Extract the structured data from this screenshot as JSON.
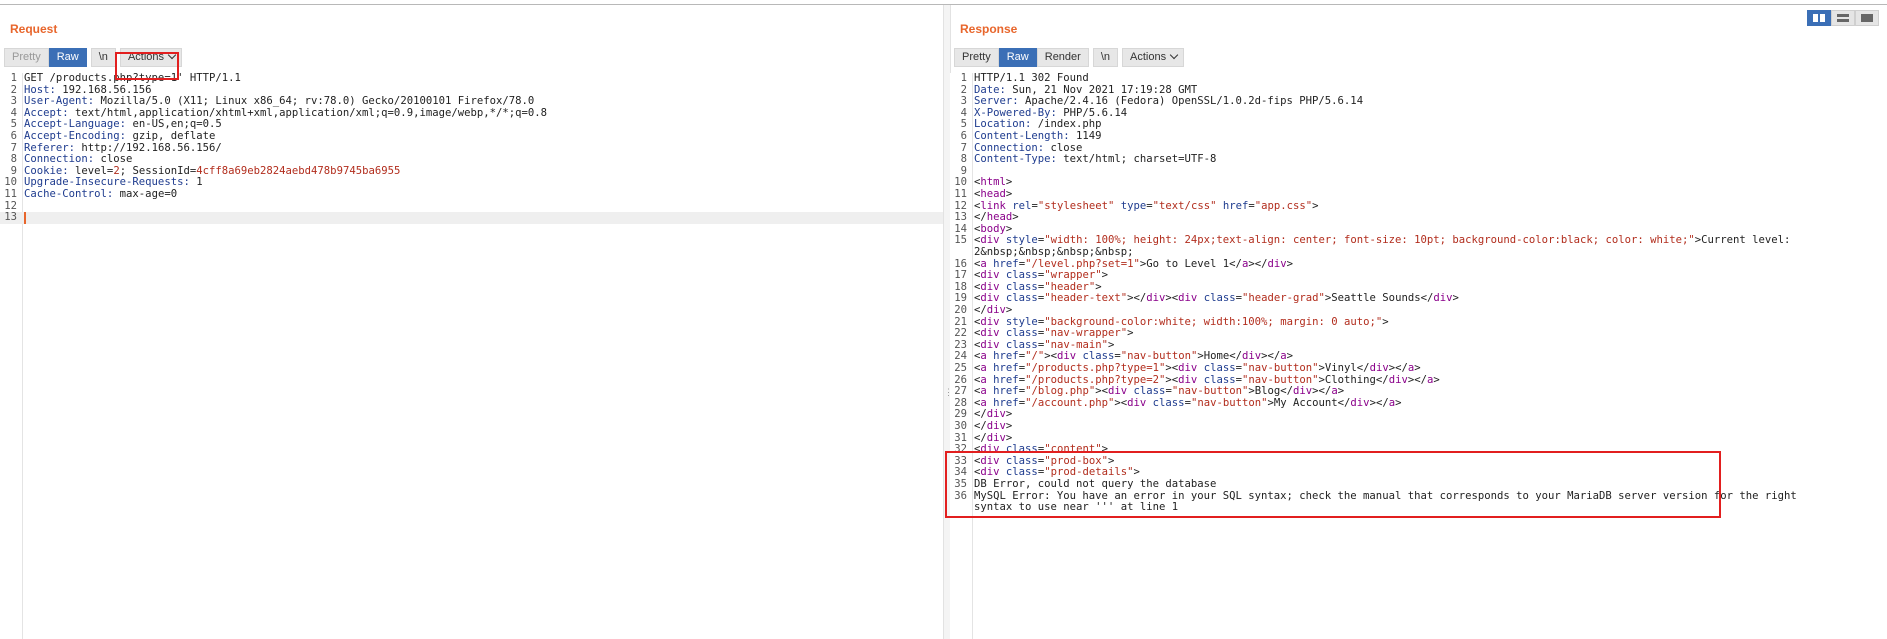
{
  "request": {
    "title": "Request",
    "tabs": {
      "pretty": "Pretty",
      "raw": "Raw",
      "newline": "\\n",
      "actions": "Actions"
    },
    "lines": [
      {
        "n": "1",
        "segs": [
          {
            "t": "GET /products.php?type=1' HTTP/1.1"
          }
        ]
      },
      {
        "n": "2",
        "segs": [
          {
            "t": "Host:",
            "c": "k"
          },
          {
            "t": " 192.168.56.156"
          }
        ]
      },
      {
        "n": "3",
        "segs": [
          {
            "t": "User-Agent:",
            "c": "k"
          },
          {
            "t": " Mozilla/5.0 (X11; Linux x86_64; rv:78.0) Gecko/20100101 Firefox/78.0"
          }
        ]
      },
      {
        "n": "4",
        "segs": [
          {
            "t": "Accept:",
            "c": "k"
          },
          {
            "t": " text/html,application/xhtml+xml,application/xml;q=0.9,image/webp,*/*;q=0.8"
          }
        ]
      },
      {
        "n": "5",
        "segs": [
          {
            "t": "Accept-Language:",
            "c": "k"
          },
          {
            "t": " en-US,en;q=0.5"
          }
        ]
      },
      {
        "n": "6",
        "segs": [
          {
            "t": "Accept-Encoding:",
            "c": "k"
          },
          {
            "t": " gzip, deflate"
          }
        ]
      },
      {
        "n": "7",
        "segs": [
          {
            "t": "Referer:",
            "c": "k"
          },
          {
            "t": " http://192.168.56.156/"
          }
        ]
      },
      {
        "n": "8",
        "segs": [
          {
            "t": "Connection:",
            "c": "k"
          },
          {
            "t": " close"
          }
        ]
      },
      {
        "n": "9",
        "segs": [
          {
            "t": "Cookie:",
            "c": "k"
          },
          {
            "t": " level="
          },
          {
            "t": "2",
            "c": "r"
          },
          {
            "t": "; SessionId="
          },
          {
            "t": "4cff8a69eb2824aebd478b9745ba6955",
            "c": "r"
          }
        ]
      },
      {
        "n": "10",
        "segs": [
          {
            "t": "Upgrade-Insecure-Requests:",
            "c": "k"
          },
          {
            "t": " 1"
          }
        ]
      },
      {
        "n": "11",
        "segs": [
          {
            "t": "Cache-Control:",
            "c": "k"
          },
          {
            "t": " max-age=0"
          }
        ]
      },
      {
        "n": "12",
        "segs": []
      },
      {
        "n": "13",
        "segs": [],
        "current": true
      }
    ]
  },
  "response": {
    "title": "Response",
    "tabs": {
      "pretty": "Pretty",
      "raw": "Raw",
      "render": "Render",
      "newline": "\\n",
      "actions": "Actions"
    },
    "lines": [
      {
        "n": "1",
        "segs": [
          {
            "t": "HTTP/1.1 302 Found"
          }
        ]
      },
      {
        "n": "2",
        "segs": [
          {
            "t": "Date:",
            "c": "k"
          },
          {
            "t": " Sun, 21 Nov 2021 17:19:28 GMT"
          }
        ]
      },
      {
        "n": "3",
        "segs": [
          {
            "t": "Server:",
            "c": "k"
          },
          {
            "t": " Apache/2.4.16 (Fedora) OpenSSL/1.0.2d-fips PHP/5.6.14"
          }
        ]
      },
      {
        "n": "4",
        "segs": [
          {
            "t": "X-Powered-By:",
            "c": "k"
          },
          {
            "t": " PHP/5.6.14"
          }
        ]
      },
      {
        "n": "5",
        "segs": [
          {
            "t": "Location:",
            "c": "k"
          },
          {
            "t": " /index.php"
          }
        ]
      },
      {
        "n": "6",
        "segs": [
          {
            "t": "Content-Length:",
            "c": "k"
          },
          {
            "t": " 1149"
          }
        ]
      },
      {
        "n": "7",
        "segs": [
          {
            "t": "Connection:",
            "c": "k"
          },
          {
            "t": " close"
          }
        ]
      },
      {
        "n": "8",
        "segs": [
          {
            "t": "Content-Type:",
            "c": "k"
          },
          {
            "t": " text/html; charset=UTF-8"
          }
        ]
      },
      {
        "n": "9",
        "segs": []
      },
      {
        "n": "10",
        "segs": [
          {
            "t": "<"
          },
          {
            "t": "html",
            "c": "tag"
          },
          {
            "t": ">"
          }
        ]
      },
      {
        "n": "11",
        "segs": [
          {
            "t": "<"
          },
          {
            "t": "head",
            "c": "tag"
          },
          {
            "t": ">"
          }
        ]
      },
      {
        "n": "12",
        "segs": [
          {
            "t": "<"
          },
          {
            "t": "link",
            "c": "tag"
          },
          {
            "t": " "
          },
          {
            "t": "rel",
            "c": "attr"
          },
          {
            "t": "="
          },
          {
            "t": "\"stylesheet\"",
            "c": "str"
          },
          {
            "t": " "
          },
          {
            "t": "type",
            "c": "attr"
          },
          {
            "t": "="
          },
          {
            "t": "\"text/css\"",
            "c": "str"
          },
          {
            "t": " "
          },
          {
            "t": "href",
            "c": "attr"
          },
          {
            "t": "="
          },
          {
            "t": "\"app.css\"",
            "c": "str"
          },
          {
            "t": ">"
          }
        ]
      },
      {
        "n": "13",
        "segs": [
          {
            "t": "</"
          },
          {
            "t": "head",
            "c": "tag"
          },
          {
            "t": ">"
          }
        ]
      },
      {
        "n": "14",
        "segs": [
          {
            "t": "<"
          },
          {
            "t": "body",
            "c": "tag"
          },
          {
            "t": ">"
          }
        ]
      },
      {
        "n": "15",
        "segs": [
          {
            "t": "<"
          },
          {
            "t": "div",
            "c": "tag"
          },
          {
            "t": " "
          },
          {
            "t": "style",
            "c": "attr"
          },
          {
            "t": "="
          },
          {
            "t": "\"width: 100%; height: 24px;text-align: center; font-size: 10pt; background-color:black; color: white;\"",
            "c": "str"
          },
          {
            "t": ">Current level:"
          }
        ]
      },
      {
        "n": "",
        "segs": [
          {
            "t": "2&nbsp;&nbsp;&nbsp;&nbsp;"
          }
        ]
      },
      {
        "n": "16",
        "segs": [
          {
            "t": "<"
          },
          {
            "t": "a",
            "c": "tag"
          },
          {
            "t": " "
          },
          {
            "t": "href",
            "c": "attr"
          },
          {
            "t": "="
          },
          {
            "t": "\"/level.php?set=1\"",
            "c": "str"
          },
          {
            "t": ">Go to Level 1</"
          },
          {
            "t": "a",
            "c": "tag"
          },
          {
            "t": "></"
          },
          {
            "t": "div",
            "c": "tag"
          },
          {
            "t": ">"
          }
        ]
      },
      {
        "n": "17",
        "segs": [
          {
            "t": "<"
          },
          {
            "t": "div",
            "c": "tag"
          },
          {
            "t": " "
          },
          {
            "t": "class",
            "c": "attr"
          },
          {
            "t": "="
          },
          {
            "t": "\"wrapper\"",
            "c": "str"
          },
          {
            "t": ">"
          }
        ]
      },
      {
        "n": "18",
        "segs": [
          {
            "t": "<"
          },
          {
            "t": "div",
            "c": "tag"
          },
          {
            "t": " "
          },
          {
            "t": "class",
            "c": "attr"
          },
          {
            "t": "="
          },
          {
            "t": "\"header\"",
            "c": "str"
          },
          {
            "t": ">"
          }
        ]
      },
      {
        "n": "19",
        "segs": [
          {
            "t": "<"
          },
          {
            "t": "div",
            "c": "tag"
          },
          {
            "t": " "
          },
          {
            "t": "class",
            "c": "attr"
          },
          {
            "t": "="
          },
          {
            "t": "\"header-text\"",
            "c": "str"
          },
          {
            "t": "></"
          },
          {
            "t": "div",
            "c": "tag"
          },
          {
            "t": "><"
          },
          {
            "t": "div",
            "c": "tag"
          },
          {
            "t": " "
          },
          {
            "t": "class",
            "c": "attr"
          },
          {
            "t": "="
          },
          {
            "t": "\"header-grad\"",
            "c": "str"
          },
          {
            "t": ">Seattle Sounds</"
          },
          {
            "t": "div",
            "c": "tag"
          },
          {
            "t": ">"
          }
        ]
      },
      {
        "n": "20",
        "segs": [
          {
            "t": "</"
          },
          {
            "t": "div",
            "c": "tag"
          },
          {
            "t": ">"
          }
        ]
      },
      {
        "n": "21",
        "segs": [
          {
            "t": "<"
          },
          {
            "t": "div",
            "c": "tag"
          },
          {
            "t": " "
          },
          {
            "t": "style",
            "c": "attr"
          },
          {
            "t": "="
          },
          {
            "t": "\"background-color:white; width:100%; margin: 0 auto;\"",
            "c": "str"
          },
          {
            "t": ">"
          }
        ]
      },
      {
        "n": "22",
        "segs": [
          {
            "t": "<"
          },
          {
            "t": "div",
            "c": "tag"
          },
          {
            "t": " "
          },
          {
            "t": "class",
            "c": "attr"
          },
          {
            "t": "="
          },
          {
            "t": "\"nav-wrapper\"",
            "c": "str"
          },
          {
            "t": ">"
          }
        ]
      },
      {
        "n": "23",
        "segs": [
          {
            "t": "<"
          },
          {
            "t": "div",
            "c": "tag"
          },
          {
            "t": " "
          },
          {
            "t": "class",
            "c": "attr"
          },
          {
            "t": "="
          },
          {
            "t": "\"nav-main\"",
            "c": "str"
          },
          {
            "t": ">"
          }
        ]
      },
      {
        "n": "24",
        "segs": [
          {
            "t": "<"
          },
          {
            "t": "a",
            "c": "tag"
          },
          {
            "t": " "
          },
          {
            "t": "href",
            "c": "attr"
          },
          {
            "t": "="
          },
          {
            "t": "\"/\"",
            "c": "str"
          },
          {
            "t": "><"
          },
          {
            "t": "div",
            "c": "tag"
          },
          {
            "t": " "
          },
          {
            "t": "class",
            "c": "attr"
          },
          {
            "t": "="
          },
          {
            "t": "\"nav-button\"",
            "c": "str"
          },
          {
            "t": ">Home</"
          },
          {
            "t": "div",
            "c": "tag"
          },
          {
            "t": "></"
          },
          {
            "t": "a",
            "c": "tag"
          },
          {
            "t": ">"
          }
        ]
      },
      {
        "n": "25",
        "segs": [
          {
            "t": "<"
          },
          {
            "t": "a",
            "c": "tag"
          },
          {
            "t": " "
          },
          {
            "t": "href",
            "c": "attr"
          },
          {
            "t": "="
          },
          {
            "t": "\"/products.php?type=1\"",
            "c": "str"
          },
          {
            "t": "><"
          },
          {
            "t": "div",
            "c": "tag"
          },
          {
            "t": " "
          },
          {
            "t": "class",
            "c": "attr"
          },
          {
            "t": "="
          },
          {
            "t": "\"nav-button\"",
            "c": "str"
          },
          {
            "t": ">Vinyl</"
          },
          {
            "t": "div",
            "c": "tag"
          },
          {
            "t": "></"
          },
          {
            "t": "a",
            "c": "tag"
          },
          {
            "t": ">"
          }
        ]
      },
      {
        "n": "26",
        "segs": [
          {
            "t": "<"
          },
          {
            "t": "a",
            "c": "tag"
          },
          {
            "t": " "
          },
          {
            "t": "href",
            "c": "attr"
          },
          {
            "t": "="
          },
          {
            "t": "\"/products.php?type=2\"",
            "c": "str"
          },
          {
            "t": "><"
          },
          {
            "t": "div",
            "c": "tag"
          },
          {
            "t": " "
          },
          {
            "t": "class",
            "c": "attr"
          },
          {
            "t": "="
          },
          {
            "t": "\"nav-button\"",
            "c": "str"
          },
          {
            "t": ">Clothing</"
          },
          {
            "t": "div",
            "c": "tag"
          },
          {
            "t": "></"
          },
          {
            "t": "a",
            "c": "tag"
          },
          {
            "t": ">"
          }
        ]
      },
      {
        "n": "27",
        "segs": [
          {
            "t": "<"
          },
          {
            "t": "a",
            "c": "tag"
          },
          {
            "t": " "
          },
          {
            "t": "href",
            "c": "attr"
          },
          {
            "t": "="
          },
          {
            "t": "\"/blog.php\"",
            "c": "str"
          },
          {
            "t": "><"
          },
          {
            "t": "div",
            "c": "tag"
          },
          {
            "t": " "
          },
          {
            "t": "class",
            "c": "attr"
          },
          {
            "t": "="
          },
          {
            "t": "\"nav-button\"",
            "c": "str"
          },
          {
            "t": ">Blog</"
          },
          {
            "t": "div",
            "c": "tag"
          },
          {
            "t": "></"
          },
          {
            "t": "a",
            "c": "tag"
          },
          {
            "t": ">"
          }
        ]
      },
      {
        "n": "28",
        "segs": [
          {
            "t": "<"
          },
          {
            "t": "a",
            "c": "tag"
          },
          {
            "t": " "
          },
          {
            "t": "href",
            "c": "attr"
          },
          {
            "t": "="
          },
          {
            "t": "\"/account.php\"",
            "c": "str"
          },
          {
            "t": "><"
          },
          {
            "t": "div",
            "c": "tag"
          },
          {
            "t": " "
          },
          {
            "t": "class",
            "c": "attr"
          },
          {
            "t": "="
          },
          {
            "t": "\"nav-button\"",
            "c": "str"
          },
          {
            "t": ">My Account</"
          },
          {
            "t": "div",
            "c": "tag"
          },
          {
            "t": "></"
          },
          {
            "t": "a",
            "c": "tag"
          },
          {
            "t": ">"
          }
        ]
      },
      {
        "n": "29",
        "segs": [
          {
            "t": "</"
          },
          {
            "t": "div",
            "c": "tag"
          },
          {
            "t": ">"
          }
        ]
      },
      {
        "n": "30",
        "segs": [
          {
            "t": "</"
          },
          {
            "t": "div",
            "c": "tag"
          },
          {
            "t": ">"
          }
        ]
      },
      {
        "n": "31",
        "segs": [
          {
            "t": "</"
          },
          {
            "t": "div",
            "c": "tag"
          },
          {
            "t": ">"
          }
        ]
      },
      {
        "n": "32",
        "segs": [
          {
            "t": "<"
          },
          {
            "t": "div",
            "c": "tag"
          },
          {
            "t": " "
          },
          {
            "t": "class",
            "c": "attr"
          },
          {
            "t": "="
          },
          {
            "t": "\"content\"",
            "c": "str"
          },
          {
            "t": ">"
          }
        ]
      },
      {
        "n": "33",
        "segs": [
          {
            "t": "<"
          },
          {
            "t": "div",
            "c": "tag"
          },
          {
            "t": " "
          },
          {
            "t": "class",
            "c": "attr"
          },
          {
            "t": "="
          },
          {
            "t": "\"prod-box\"",
            "c": "str"
          },
          {
            "t": ">"
          }
        ]
      },
      {
        "n": "34",
        "segs": [
          {
            "t": "<"
          },
          {
            "t": "div",
            "c": "tag"
          },
          {
            "t": " "
          },
          {
            "t": "class",
            "c": "attr"
          },
          {
            "t": "="
          },
          {
            "t": "\"prod-details\"",
            "c": "str"
          },
          {
            "t": ">"
          }
        ]
      },
      {
        "n": "35",
        "segs": [
          {
            "t": "DB Error, could not query the database"
          }
        ]
      },
      {
        "n": "36",
        "segs": [
          {
            "t": "MySQL Error: You have an error in your SQL syntax; check the manual that corresponds to your MariaDB server version for the right"
          }
        ]
      },
      {
        "n": "",
        "segs": [
          {
            "t": "syntax to use near ''' at line 1"
          }
        ]
      }
    ]
  },
  "colors": {
    "accent_orange": "#e8662c",
    "active_tab_blue": "#3b6fb6",
    "highlight_red": "#e21f1f"
  },
  "icons": {
    "view_toggle": [
      "split-columns-icon",
      "split-rows-icon",
      "single-pane-icon"
    ]
  }
}
